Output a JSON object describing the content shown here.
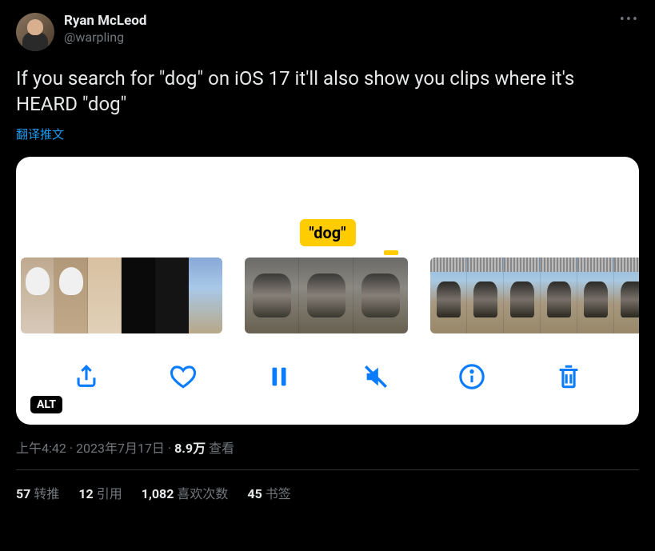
{
  "author": {
    "display_name": "Ryan McLeod",
    "handle": "@warpling"
  },
  "body_text": "If you search for \"dog\" on iOS 17 it'll also show you clips where it's HEARD \"dog\"",
  "translate_label": "翻译推文",
  "media": {
    "highlight_label": "\"dog\"",
    "alt_badge": "ALT"
  },
  "meta": {
    "time": "上午4:42",
    "date": "2023年7月17日",
    "views_count": "8.9万",
    "views_label": "查看",
    "separator": " · "
  },
  "stats": {
    "retweets": {
      "count": "57",
      "label": "转推"
    },
    "quotes": {
      "count": "12",
      "label": "引用"
    },
    "likes": {
      "count": "1,082",
      "label": "喜欢次数"
    },
    "bookmarks": {
      "count": "45",
      "label": "书签"
    }
  }
}
